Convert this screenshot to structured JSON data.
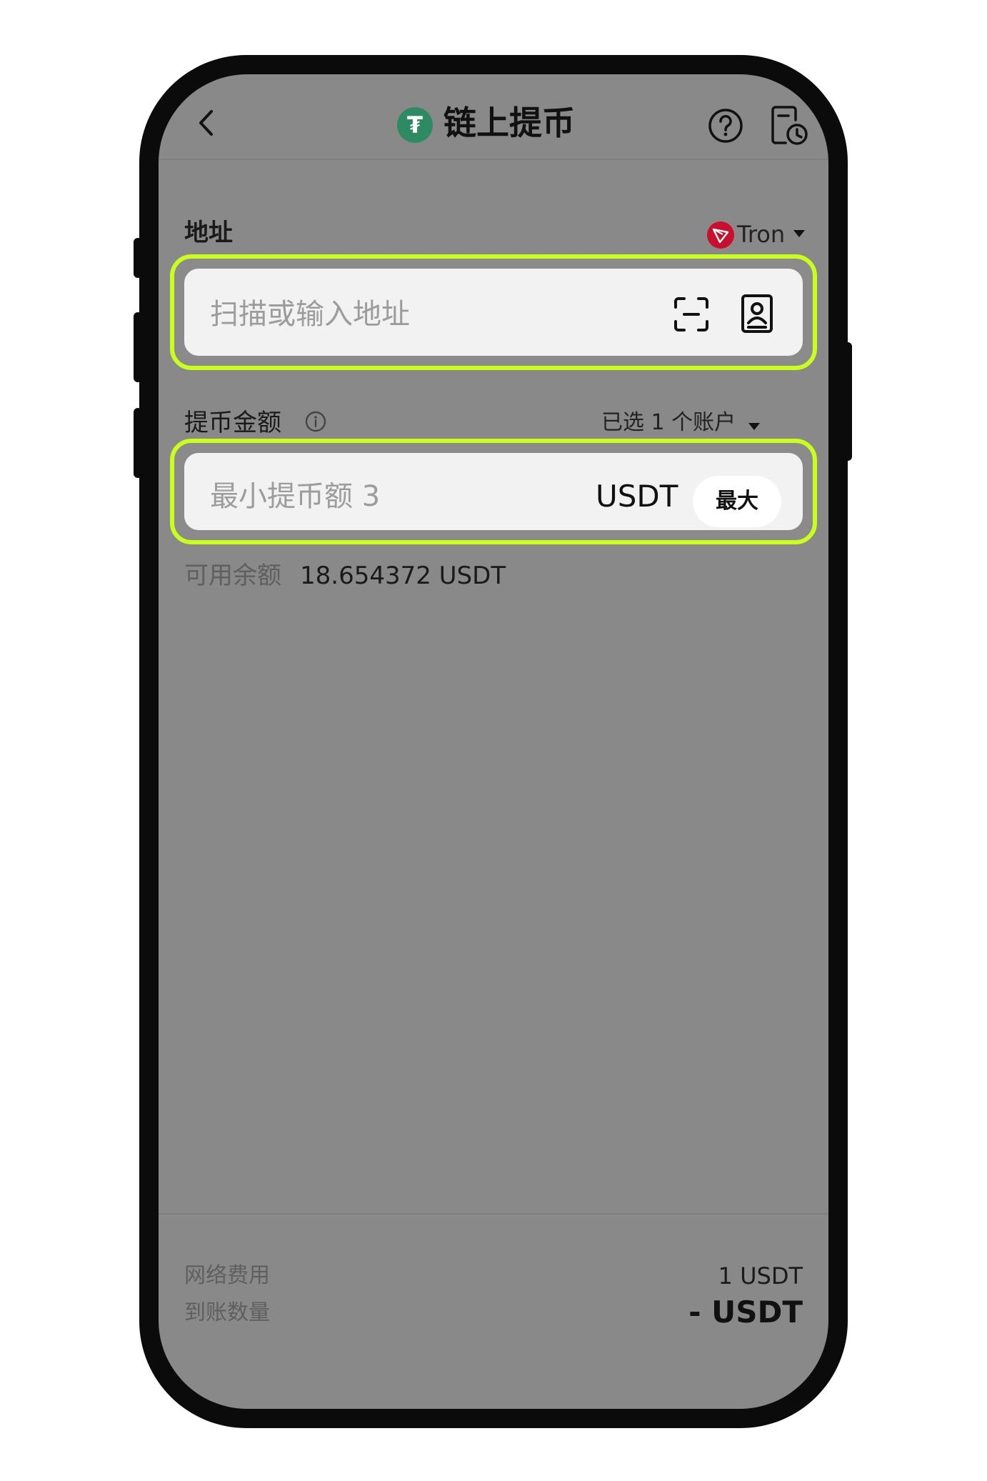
{
  "header": {
    "title": "链上提币",
    "coin_icon": "tether-icon",
    "coin_symbol": "₮",
    "back_icon": "chevron-left-icon",
    "help_icon": "help-icon",
    "history_icon": "history-icon"
  },
  "address": {
    "label": "地址",
    "network": "Tron",
    "network_icon": "tron-icon",
    "placeholder": "扫描或输入地址",
    "scan_icon": "scan-icon",
    "book_icon": "address-book-icon"
  },
  "amount": {
    "label": "提币金额",
    "info_icon": "info-icon",
    "account_selector": "已选 1 个账户",
    "placeholder": "最小提币额 3",
    "currency": "USDT",
    "max_label": "最大"
  },
  "balance": {
    "label": "可用余额",
    "value": "18.654372 USDT"
  },
  "footer": {
    "fee_label": "网络费用",
    "fee_value": "1 USDT",
    "received_label": "到账数量",
    "received_value": "- USDT"
  },
  "colors": {
    "highlight": "#c8ff1c",
    "tether_green": "#2e8a63",
    "tron_red": "#c8102e",
    "overlay": "#898989"
  }
}
